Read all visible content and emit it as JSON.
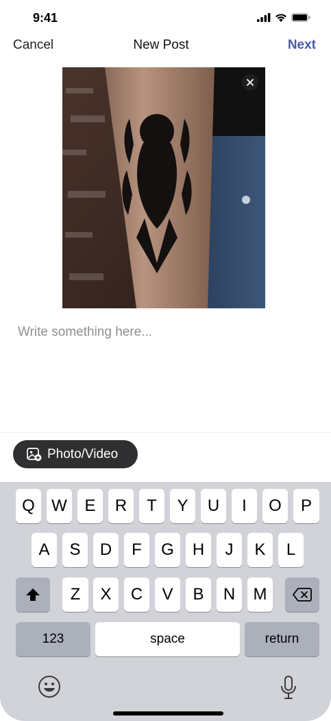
{
  "status": {
    "time": "9:41"
  },
  "nav": {
    "cancel_label": "Cancel",
    "title": "New Post",
    "next_label": "Next"
  },
  "photo": {
    "remove_icon": "close-icon"
  },
  "caption": {
    "placeholder": "Write something here...",
    "value": ""
  },
  "media_button": {
    "label": "Photo/Video",
    "icon": "add-photo-icon"
  },
  "keyboard": {
    "row1": [
      "Q",
      "W",
      "E",
      "R",
      "T",
      "Y",
      "U",
      "I",
      "O",
      "P"
    ],
    "row2": [
      "A",
      "S",
      "D",
      "F",
      "G",
      "H",
      "J",
      "K",
      "L"
    ],
    "row3": [
      "Z",
      "X",
      "C",
      "V",
      "B",
      "N",
      "M"
    ],
    "numbers_label": "123",
    "space_label": "space",
    "return_label": "return",
    "shift_icon": "shift-icon",
    "backspace_icon": "backspace-icon",
    "emoji_icon": "emoji-icon",
    "mic_icon": "microphone-icon"
  },
  "colors": {
    "accent": "#4b59b0",
    "keyboard_bg": "#d1d3d9",
    "dark_key": "#abb0bb",
    "button_bg": "#2f2f31"
  }
}
